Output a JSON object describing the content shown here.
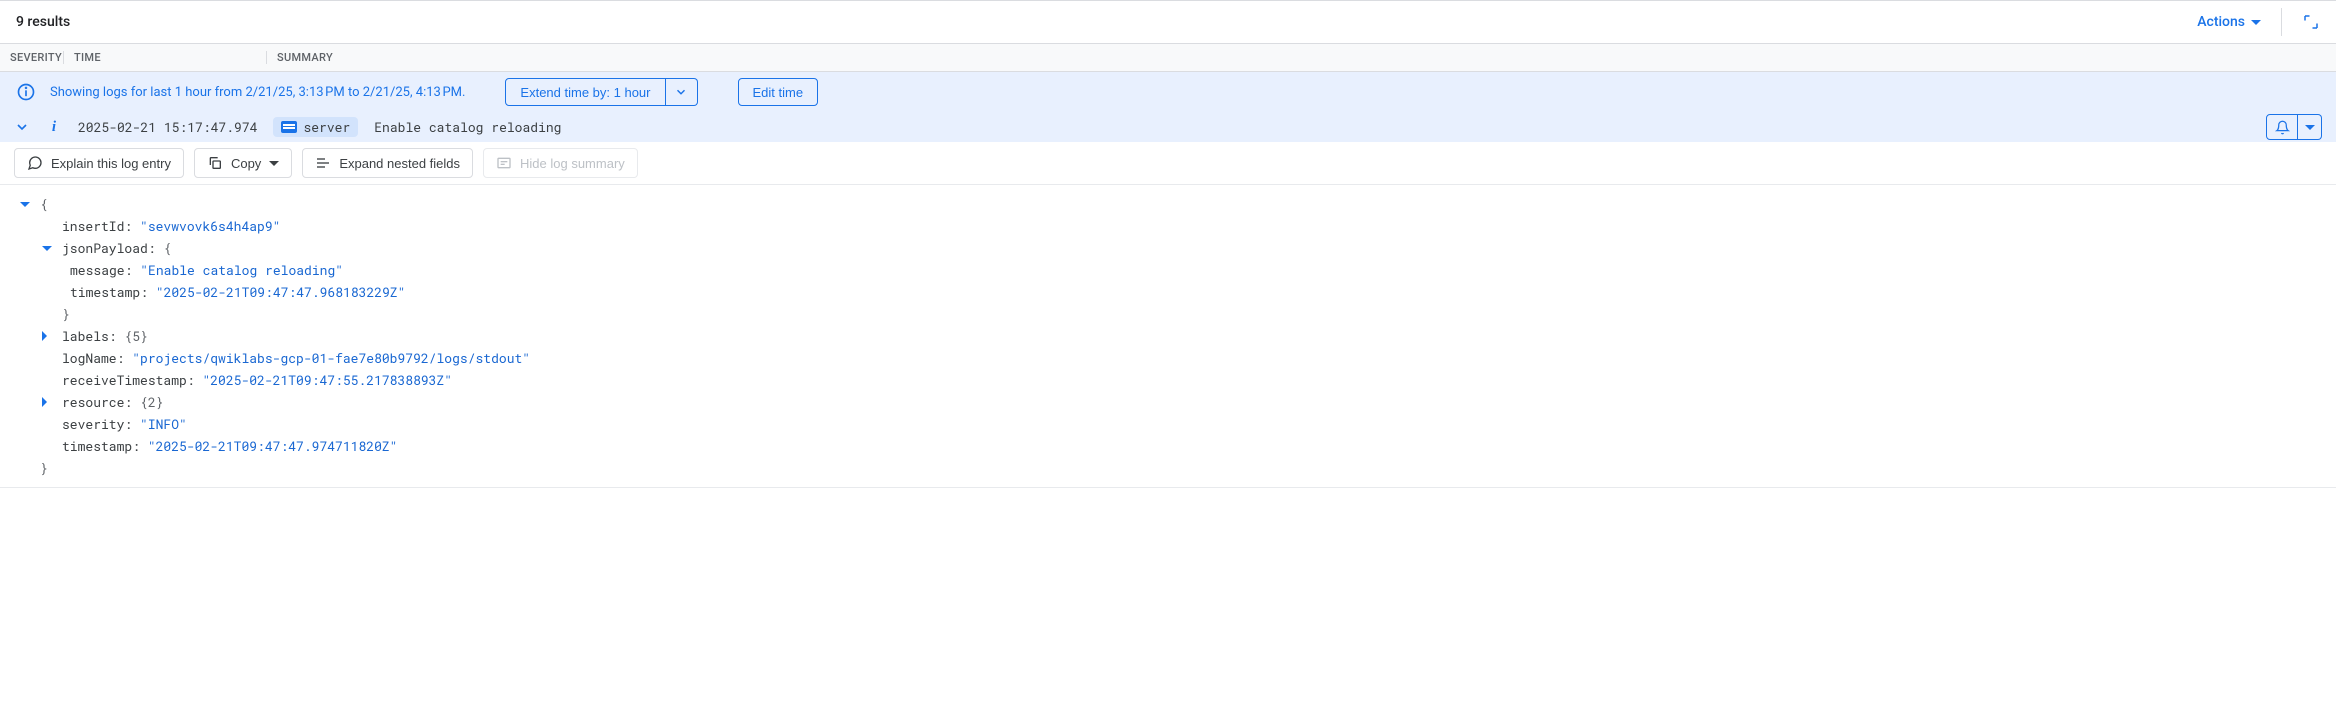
{
  "results_label": "9 results",
  "actions_label": "Actions",
  "headers": {
    "severity": "SEVERITY",
    "time": "TIME",
    "summary": "SUMMARY"
  },
  "banner": {
    "text": "Showing logs for last 1 hour from 2/21/25, 3:13 PM to 2/21/25, 4:13 PM.",
    "extend": "Extend time by: 1 hour",
    "edit": "Edit time"
  },
  "row": {
    "time": "2025-02-21 15:17:47.974",
    "chip": "server",
    "message": "Enable catalog reloading"
  },
  "actions": {
    "explain": "Explain this log entry",
    "copy": "Copy",
    "expand": "Expand nested fields",
    "hide": "Hide log summary"
  },
  "json": {
    "insertId_key": "insertId:",
    "insertId_val": "\"sevwvovk6s4h4ap9\"",
    "jsonPayload_key": "jsonPayload:",
    "message_key": "message:",
    "message_val": "\"Enable catalog reloading\"",
    "timestamp1_key": "timestamp:",
    "timestamp1_val": "\"2025-02-21T09:47:47.968183229Z\"",
    "labels_key": "labels:",
    "labels_val": "{5}",
    "logName_key": "logName:",
    "logName_val": "\"projects/qwiklabs-gcp-01-fae7e80b9792/logs/stdout\"",
    "receiveTimestamp_key": "receiveTimestamp:",
    "receiveTimestamp_val": "\"2025-02-21T09:47:55.217838893Z\"",
    "resource_key": "resource:",
    "resource_val": "{2}",
    "severity_key": "severity:",
    "severity_val": "\"INFO\"",
    "timestamp2_key": "timestamp:",
    "timestamp2_val": "\"2025-02-21T09:47:47.974711820Z\""
  }
}
